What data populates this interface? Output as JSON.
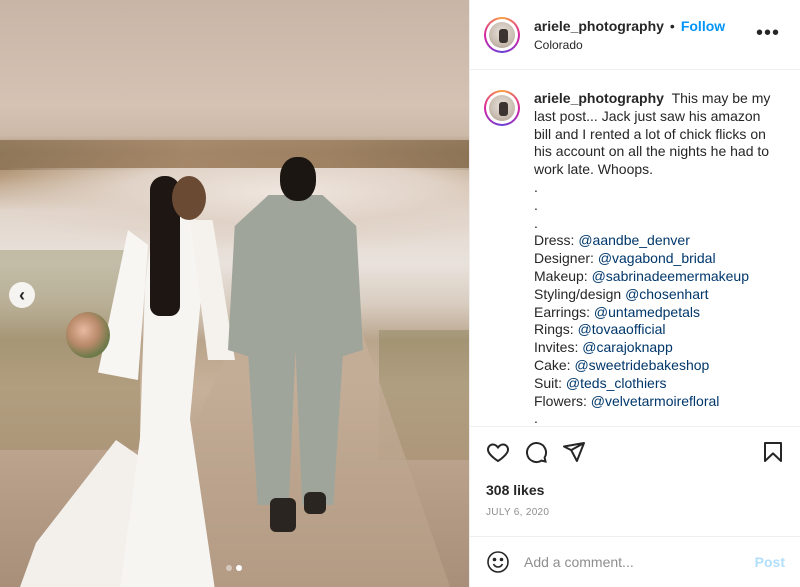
{
  "post": {
    "photo": {
      "alt_icon": "wedding-photo",
      "carousel_index": 2,
      "carousel_total": 2
    },
    "header": {
      "username": "ariele_photography",
      "separator": "•",
      "follow_label": "Follow",
      "location": "Colorado",
      "more_label": "•••"
    },
    "caption": {
      "username": "ariele_photography",
      "text": "This may be my last post... Jack just saw his amazon bill and I rented a lot of chick flicks on his account on all the nights he had to work late. Whoops.",
      "dots": [
        ".",
        ".",
        "."
      ],
      "credits": [
        {
          "role": "Dress:",
          "handle": "@aandbe_denver"
        },
        {
          "role": "Designer:",
          "handle": "@vagabond_bridal"
        },
        {
          "role": "Makeup:",
          "handle": "@sabrinadeemermakeup"
        },
        {
          "role": "Styling/design",
          "handle": "@chosenhart"
        },
        {
          "role": "Earrings:",
          "handle": "@untamedpetals"
        },
        {
          "role": "Rings:",
          "handle": "@tovaaofficial"
        },
        {
          "role": "Invites:",
          "handle": "@carajoknapp"
        },
        {
          "role": "Cake:",
          "handle": "@sweetridebakeshop"
        },
        {
          "role": "Suit:",
          "handle": "@teds_clothiers"
        },
        {
          "role": "Flowers:",
          "handle": "@velvetarmoirefloral"
        }
      ],
      "trailing_dot": "."
    },
    "actions": {
      "icons": [
        "heart-icon",
        "comment-icon",
        "share-icon",
        "bookmark-icon"
      ]
    },
    "likes": "308 likes",
    "date": "JULY 6, 2020",
    "comment": {
      "placeholder": "Add a comment...",
      "post_label": "Post"
    }
  },
  "colors": {
    "follow": "#0095f6",
    "mention": "#00376b",
    "post_disabled": "#b2dffc",
    "muted": "#8e8e8e"
  }
}
